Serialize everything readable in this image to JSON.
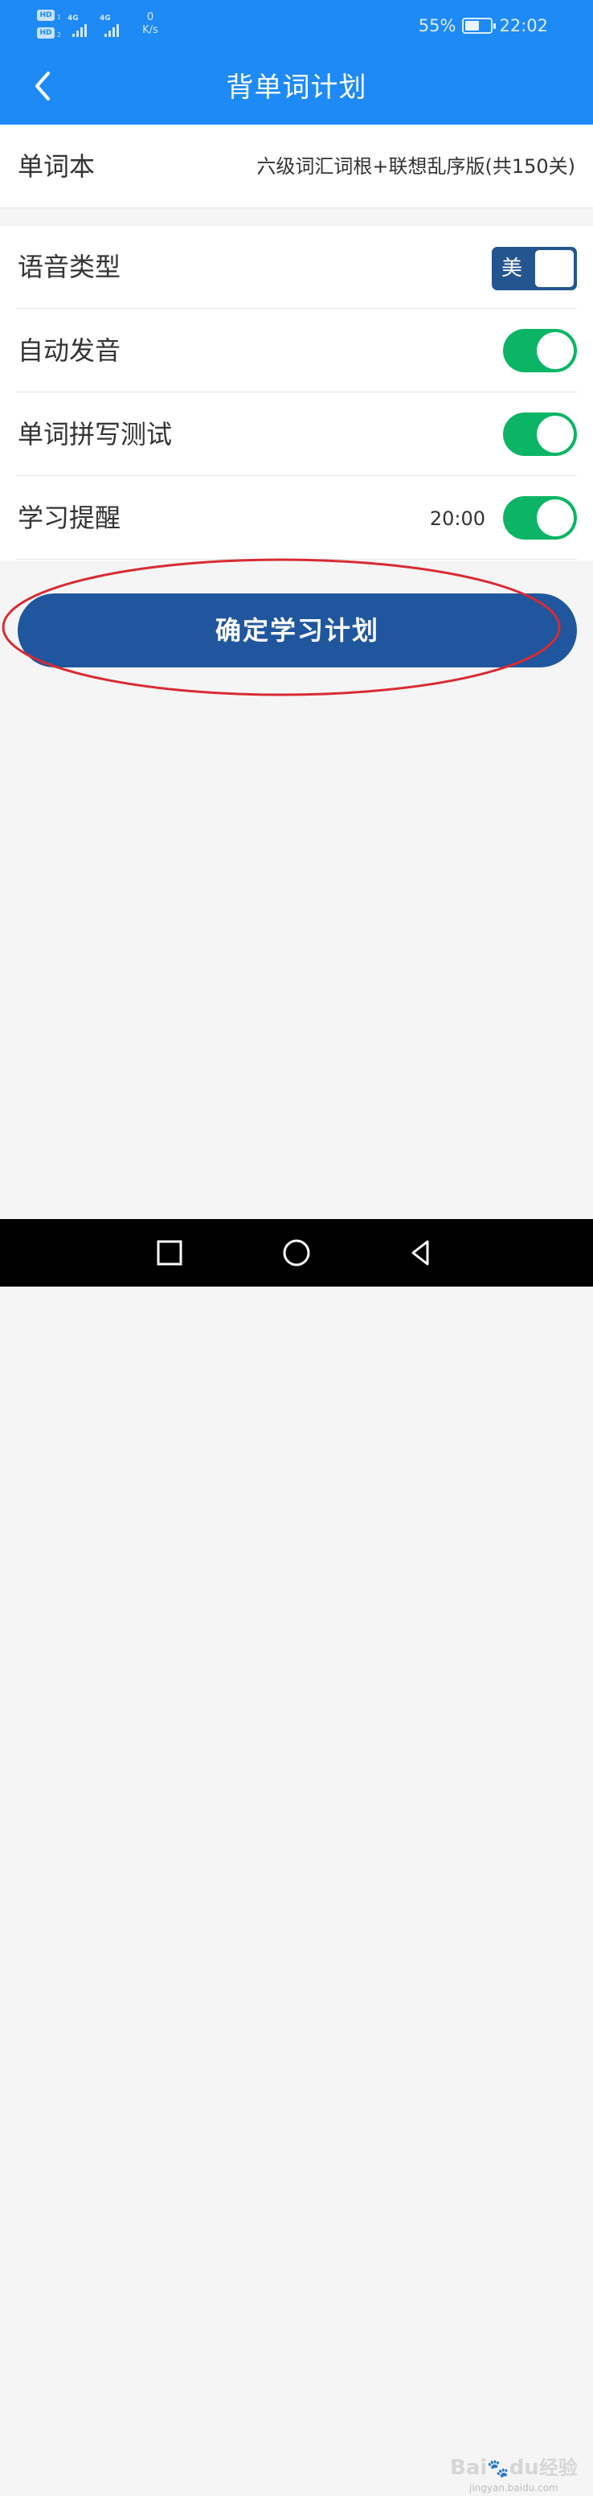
{
  "status_bar": {
    "hd_1": "HD",
    "hd_1_sub": "1",
    "hd_2": "HD",
    "hd_2_sub": "2",
    "network_1": "4G",
    "network_2": "4G",
    "speed_value": "0",
    "speed_unit": "K/s",
    "battery_percent": "55%",
    "battery_level": 0.55,
    "time": "22:02"
  },
  "header": {
    "title": "背单词计划"
  },
  "wordbook": {
    "label": "单词本",
    "value": "六级词汇词根+联想乱序版(共150关)"
  },
  "settings": {
    "voice_type": {
      "label": "语音类型",
      "value": "美"
    },
    "auto_pronounce": {
      "label": "自动发音",
      "enabled": true
    },
    "spelling_test": {
      "label": "单词拼写测试",
      "enabled": true
    },
    "study_reminder": {
      "label": "学习提醒",
      "time": "20:00",
      "enabled": true
    }
  },
  "confirm_button": {
    "label": "确定学习计划"
  },
  "annotation": {
    "color": "#d82b33"
  },
  "colors": {
    "header_blue": "#1e8af5",
    "button_blue": "#20569d",
    "toggle_green": "#0bb565"
  },
  "watermark": {
    "brand": "Bai",
    "brand_mark": "du",
    "brand_suffix": "经验",
    "url": "jingyan.baidu.com"
  }
}
